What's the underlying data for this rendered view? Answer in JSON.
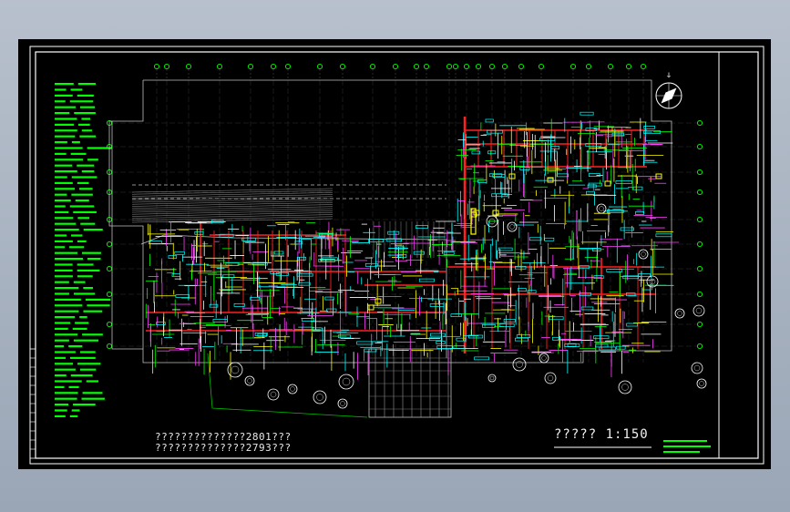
{
  "viewer": {
    "background_color": "#000000",
    "frame_color": "#ffffff",
    "wall_color": "#ff2020",
    "pipe_color": "#00ff00",
    "tag_color": "#00ffff",
    "accent_color": "#ffff00"
  },
  "drawing": {
    "notes": [
      "??????????????2801???",
      "??????????????2793???"
    ],
    "scale_title": "????? 1:150",
    "compass_icon": "north-arrow-icon",
    "legend_icon": "legend-block-icon"
  }
}
